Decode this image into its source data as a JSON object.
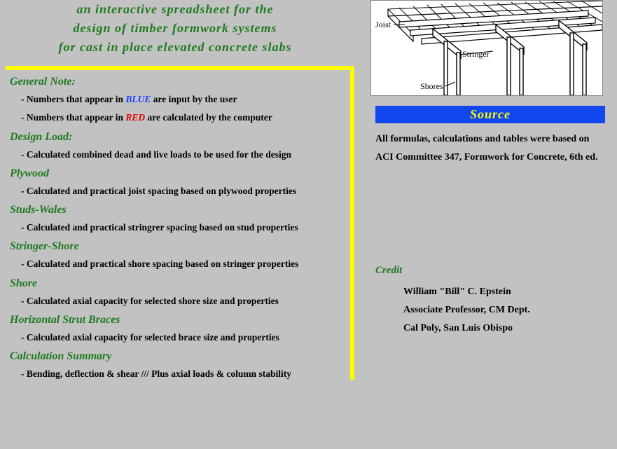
{
  "title": {
    "line1": "an  interactive  spreadsheet  for  the",
    "line2": "design  of  timber  formwork  systems",
    "line3": "for cast in place elevated concrete slabs"
  },
  "general_note": {
    "heading": "General Note:",
    "line1_prefix": "Numbers that appear in  ",
    "line1_word": "BLUE",
    "line1_suffix": "  are input by the user",
    "line2_prefix": "Numbers that appear in  ",
    "line2_word": "RED",
    "line2_suffix": "   are calculated by the computer"
  },
  "sections": {
    "design_load": {
      "heading": "Design Load:",
      "desc": "Calculated combined dead and live loads to be used for the design"
    },
    "plywood": {
      "heading": "Plywood",
      "desc": "Calculated and practical joist spacing based on plywood properties"
    },
    "studs_wales": {
      "heading": "Studs-Wales",
      "desc": "Calculated and practical stringrer spacing based on stud properties"
    },
    "stringer_shore": {
      "heading": "Stringer-Shore",
      "desc": "Calculated and practical shore spacing based on stringer properties"
    },
    "shore": {
      "heading": "Shore",
      "desc": "Calculated axial capacity for selected shore size and properties"
    },
    "hsb": {
      "heading": "Horizontal Strut Braces",
      "desc": "Calculated axial capacity for selected brace size and properties"
    },
    "calc_summary": {
      "heading": "Calculation Summary",
      "desc": "Bending, deflection & shear /// Plus axial loads & column stability"
    }
  },
  "diagram": {
    "label_joist": "Joist",
    "label_stringer": "Stringer",
    "label_shores": "Shores"
  },
  "source": {
    "heading": "Source",
    "text": "All formulas, calculations and tables were based on ACI Committee 347, Formwork for Concrete,  6th ed."
  },
  "credit": {
    "heading": "Credit",
    "name": "William \"Bill\" C. Epstein",
    "title": "Associate Professor, CM Dept.",
    "org": "Cal Poly, San Luis Obispo"
  }
}
